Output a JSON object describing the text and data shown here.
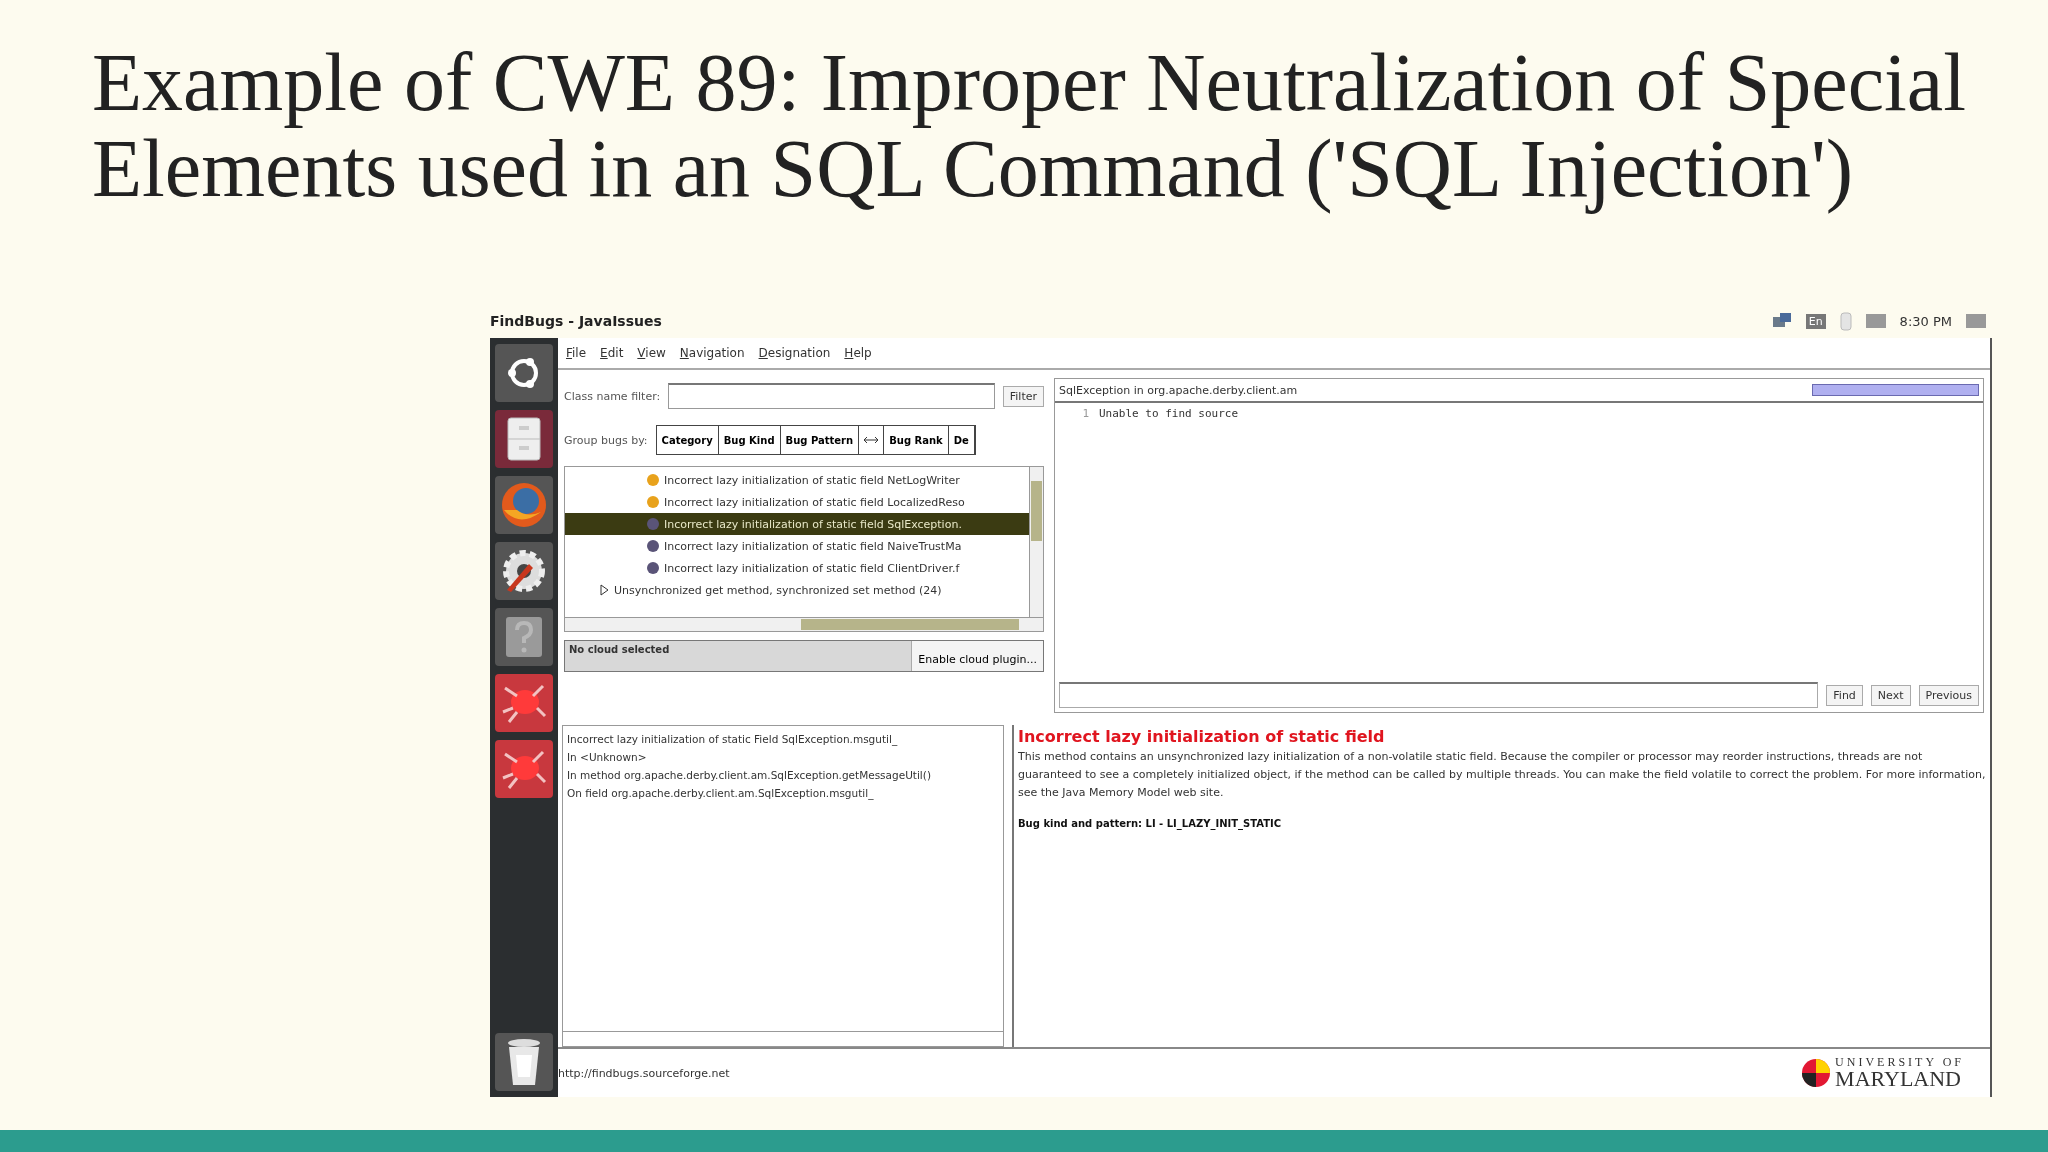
{
  "slide": {
    "title": "Example of CWE 89: Improper Neutralization of Special Elements used in an SQL Command ('SQL Injection')"
  },
  "window": {
    "title": "FindBugs - JavaIssues"
  },
  "tray": {
    "keyboard": "En",
    "clock": "8:30 PM"
  },
  "menu": [
    "File",
    "Edit",
    "View",
    "Navigation",
    "Designation",
    "Help"
  ],
  "class_filter": {
    "label": "Class name filter:",
    "button": "Filter"
  },
  "group_by": {
    "label": "Group bugs by:",
    "columns": [
      "Category",
      "Bug Kind",
      "Bug Pattern",
      "Bug Rank",
      "De"
    ]
  },
  "bug_tree": {
    "items": [
      {
        "kind": "bug",
        "label": "Incorrect lazy initialization of static field NetLogWriter",
        "color": "#e8a21c",
        "selected": false
      },
      {
        "kind": "bug",
        "label": "Incorrect lazy initialization of static field LocalizedReso",
        "color": "#e8a21c",
        "selected": false
      },
      {
        "kind": "bug",
        "label": "Incorrect lazy initialization of static field SqlException.",
        "color": "#5a5478",
        "selected": true
      },
      {
        "kind": "bug",
        "label": "Incorrect lazy initialization of static field NaiveTrustMa",
        "color": "#5a5478",
        "selected": false
      },
      {
        "kind": "bug",
        "label": "Incorrect lazy initialization of static field ClientDriver.f",
        "color": "#5a5478",
        "selected": false
      },
      {
        "kind": "category",
        "label": "Unsynchronized get method, synchronized set method (24)",
        "expanded": false
      }
    ]
  },
  "cloud": {
    "status": "No cloud selected",
    "button": "Enable cloud plugin..."
  },
  "source": {
    "title": "SqlException in org.apache.derby.client.am",
    "lines": [
      {
        "number": "1",
        "text": "Unable to find source"
      }
    ],
    "find_buttons": [
      "Find",
      "Next",
      "Previous"
    ]
  },
  "summary": {
    "lines": [
      "Incorrect lazy initialization of static Field SqlException.msgutil_",
      "In <Unknown>",
      "In method org.apache.derby.client.am.SqlException.getMessageUtil()",
      "On field org.apache.derby.client.am.SqlException.msgutil_"
    ]
  },
  "details": {
    "title": "Incorrect lazy initialization of static field",
    "description": "This method contains an unsynchronized lazy initialization of a non-volatile static field. Because the compiler or processor may reorder instructions, threads are not guaranteed to see a completely initialized object, if the method can be called by multiple threads. You can make the field volatile to correct the problem. For more information, see the Java Memory Model web site.",
    "pattern": "Bug kind and pattern: LI - LI_LAZY_INIT_STATIC"
  },
  "status_bar": {
    "url": "http://findbugs.sourceforge.net"
  },
  "logo": {
    "line_1": "UNIVERSITY OF",
    "line_2": "MARYLAND"
  }
}
